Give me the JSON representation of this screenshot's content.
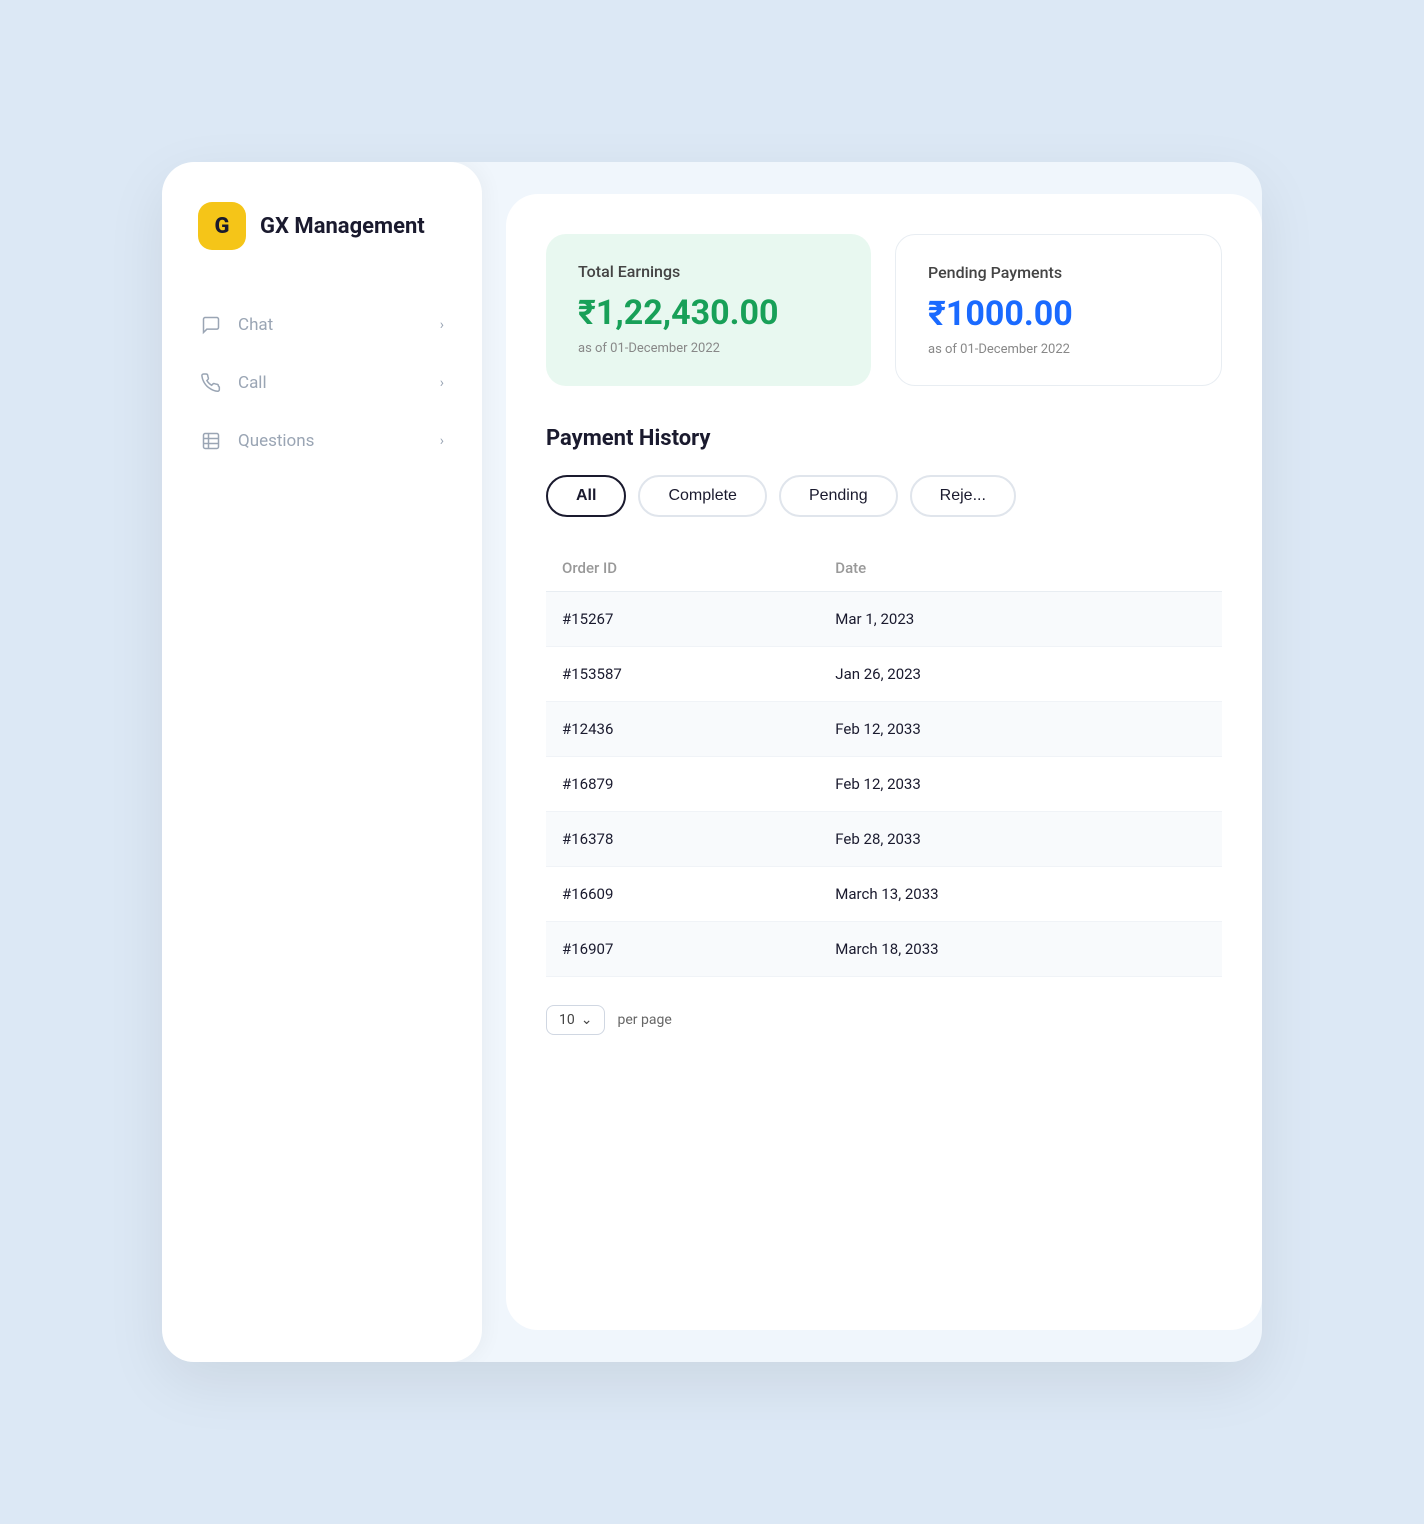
{
  "app": {
    "logo_letter": "G",
    "title": "GX Management"
  },
  "sidebar": {
    "nav_items": [
      {
        "id": "chat",
        "label": "Chat",
        "icon": "chat-icon"
      },
      {
        "id": "call",
        "label": "Call",
        "icon": "call-icon"
      },
      {
        "id": "questions",
        "label": "Questions",
        "icon": "questions-icon"
      }
    ]
  },
  "main": {
    "earnings_card": {
      "label": "Total Earnings",
      "amount": "₹1,22,430.00",
      "date": "as of 01-December 2022"
    },
    "pending_card": {
      "label": "Pending Payments",
      "amount": "₹1000.00",
      "date": "as of 01-December 2022"
    },
    "payment_history": {
      "title": "Payment History",
      "filters": [
        {
          "id": "all",
          "label": "All",
          "active": true
        },
        {
          "id": "complete",
          "label": "Complete",
          "active": false
        },
        {
          "id": "pending",
          "label": "Pending",
          "active": false
        },
        {
          "id": "rejected",
          "label": "Reje...",
          "active": false
        }
      ],
      "table_headers": [
        "Order ID",
        "Date"
      ],
      "rows": [
        {
          "order_id": "#15267",
          "date": "Mar 1, 2023"
        },
        {
          "order_id": "#153587",
          "date": "Jan 26, 2023"
        },
        {
          "order_id": "#12436",
          "date": "Feb 12, 2033"
        },
        {
          "order_id": "#16879",
          "date": "Feb 12, 2033"
        },
        {
          "order_id": "#16378",
          "date": "Feb 28, 2033"
        },
        {
          "order_id": "#16609",
          "date": "March 13, 2033"
        },
        {
          "order_id": "#16907",
          "date": "March 18, 2033"
        }
      ],
      "per_page": "10",
      "per_page_label": "per page"
    }
  }
}
